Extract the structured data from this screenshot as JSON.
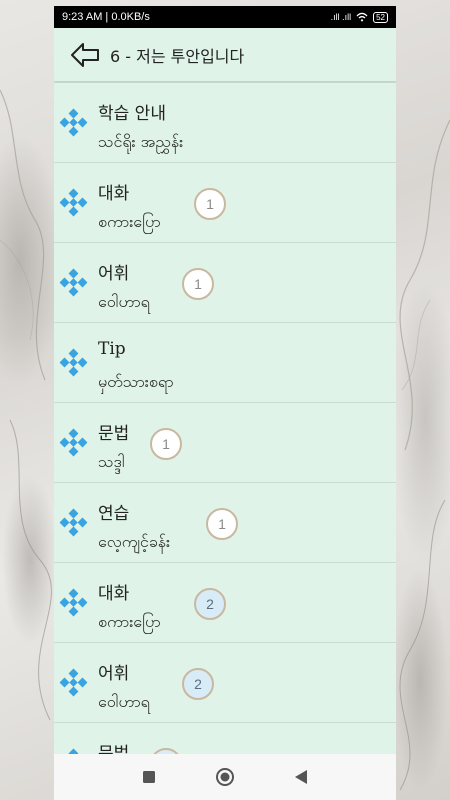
{
  "status_bar": {
    "time": "9:23 AM | 0.0KB/s",
    "signal": ".ıll .ıll",
    "battery": "52"
  },
  "app_bar": {
    "title": "6 - 저는 투안입니다",
    "back_icon": "back-arrow-icon"
  },
  "list": [
    {
      "ko": "학습 안내",
      "my": "သင်ရိုး အညွှန်း",
      "badge": ""
    },
    {
      "ko": "대화",
      "my": "စကားပြော",
      "badge": "1",
      "badge_style": "white"
    },
    {
      "ko": "어휘",
      "my": "ဝေါဟာရ",
      "badge": "1",
      "badge_style": "white"
    },
    {
      "ko": "Tip",
      "my": "မှတ်သားစရာ",
      "badge": ""
    },
    {
      "ko": "문법",
      "my": "သဒ္ဒါ",
      "badge": "1",
      "badge_style": "white"
    },
    {
      "ko": "연습",
      "my": "လေ့ကျင့်ခန်း",
      "badge": "1",
      "badge_style": "white"
    },
    {
      "ko": "대화",
      "my": "စကားပြော",
      "badge": "2",
      "badge_style": "blue"
    },
    {
      "ko": "어휘",
      "my": "ဝေါဟာရ",
      "badge": "2",
      "badge_style": "blue"
    },
    {
      "ko": "문법",
      "my": "",
      "badge": "",
      "badge_style": "blue"
    }
  ],
  "colors": {
    "background": "#dff3e8",
    "bullet": "#3aa3e0",
    "badge_border": "#c9b89f"
  },
  "nav_bar": {
    "recents_icon": "square-icon",
    "home_icon": "circle-icon",
    "back_icon": "triangle-back-icon"
  }
}
